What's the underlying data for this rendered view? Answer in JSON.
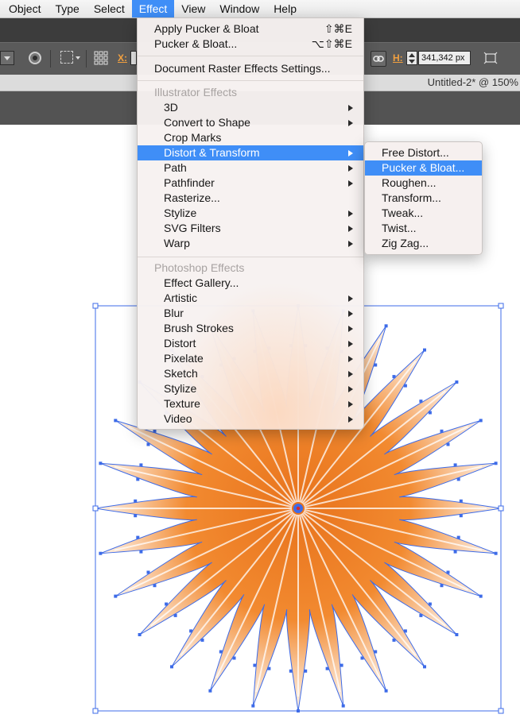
{
  "menubar": {
    "items": [
      "Object",
      "Type",
      "Select",
      "Effect",
      "View",
      "Window",
      "Help"
    ],
    "active": "Effect"
  },
  "controlbar": {
    "x_label": "X:",
    "h_label": "H:",
    "h_value": "341,342 px"
  },
  "document": {
    "tab_title": "Untitled-2* @ 150%"
  },
  "effect_menu": {
    "apply_label": "Apply Pucker & Bloat",
    "apply_shortcut": "⇧⌘E",
    "last_label": "Pucker & Bloat...",
    "last_shortcut": "⌥⇧⌘E",
    "raster_settings": "Document Raster Effects Settings...",
    "illustrator_header": "Illustrator Effects",
    "illustrator_items": [
      "3D",
      "Convert to Shape",
      "Crop Marks",
      "Distort & Transform",
      "Path",
      "Pathfinder",
      "Rasterize...",
      "Stylize",
      "SVG Filters",
      "Warp"
    ],
    "illustrator_submenu_flags": [
      true,
      true,
      false,
      true,
      true,
      true,
      false,
      true,
      true,
      true
    ],
    "photoshop_header": "Photoshop Effects",
    "photoshop_items": [
      "Effect Gallery...",
      "Artistic",
      "Blur",
      "Brush Strokes",
      "Distort",
      "Pixelate",
      "Sketch",
      "Stylize",
      "Texture",
      "Video"
    ],
    "photoshop_submenu_flags": [
      false,
      true,
      true,
      true,
      true,
      true,
      true,
      true,
      true,
      true
    ],
    "highlighted": "Distort & Transform"
  },
  "submenu": {
    "items": [
      "Free Distort...",
      "Pucker & Bloat...",
      "Roughen...",
      "Transform...",
      "Tweak...",
      "Twist...",
      "Zig Zag..."
    ],
    "highlighted": "Pucker & Bloat..."
  },
  "colors": {
    "menu_highlight": "#3f8ef7",
    "star_fill": "#f07a1e",
    "selection": "#3d6be8"
  },
  "star": {
    "spikes": 28
  }
}
